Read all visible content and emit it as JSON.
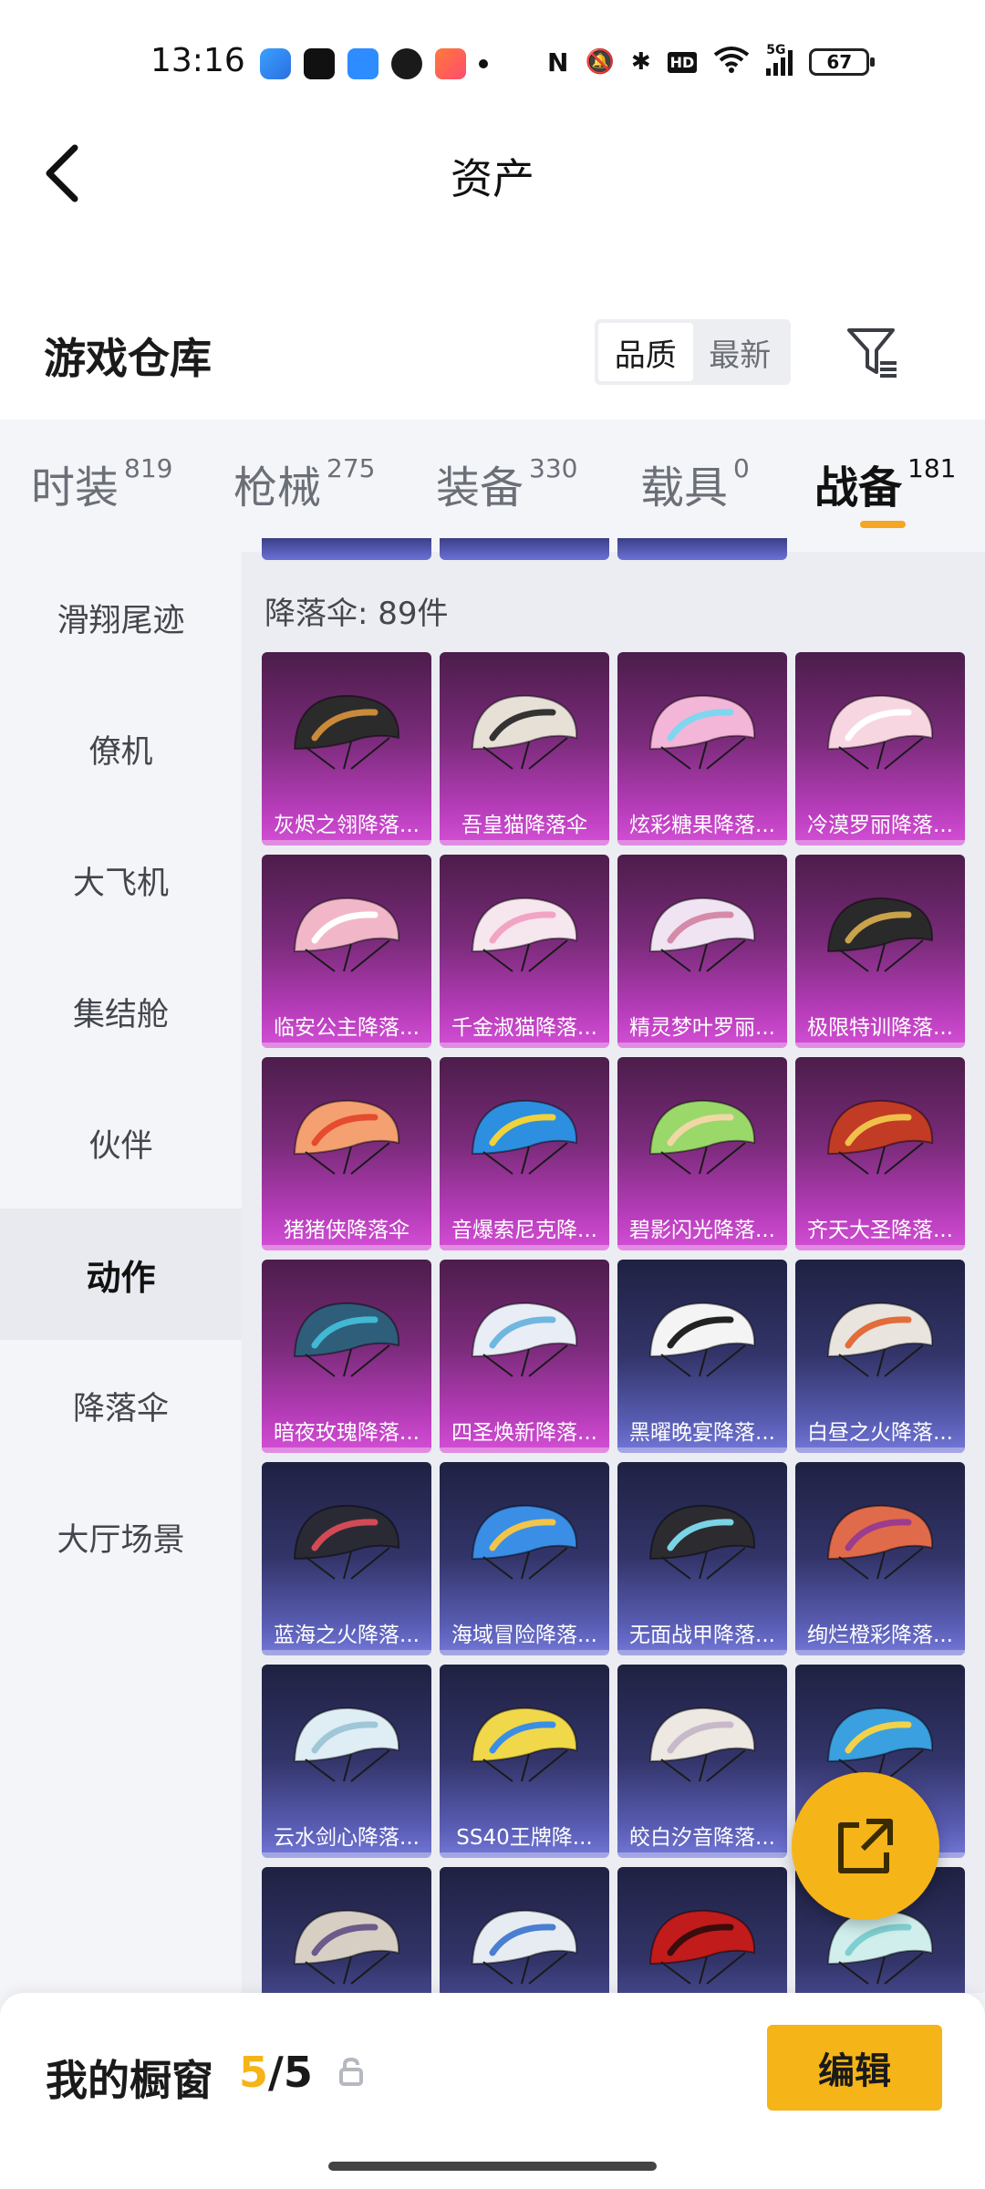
{
  "status_bar": {
    "time": "13:16",
    "network": "5G",
    "hd": "HD",
    "battery": "67",
    "icons": [
      "app-icon",
      "tiktok-icon",
      "app-icon",
      "wechat-icon",
      "game-icon",
      "dot-icon",
      "nfc-icon",
      "mute-icon",
      "bluetooth-icon",
      "wifi-icon",
      "signal-icon",
      "battery-icon"
    ]
  },
  "header": {
    "title": "资产",
    "back_icon": "chevron-left-icon"
  },
  "warehouse": {
    "title": "游戏仓库",
    "sort_options": [
      "品质",
      "最新"
    ],
    "active_sort": "品质",
    "filter_icon": "filter-icon"
  },
  "tabs": [
    {
      "label": "时装",
      "count": "819"
    },
    {
      "label": "枪械",
      "count": "275"
    },
    {
      "label": "装备",
      "count": "330"
    },
    {
      "label": "载具",
      "count": "0"
    },
    {
      "label": "战备",
      "count": "181"
    }
  ],
  "active_tab": "战备",
  "sidebar": {
    "items": [
      "滑翔尾迹",
      "僚机",
      "大飞机",
      "集结舱",
      "伙伴",
      "动作",
      "降落伞",
      "大厅场景"
    ],
    "active": "动作"
  },
  "grid": {
    "section_label": "降落伞: 89件",
    "items": [
      {
        "name": "灰烬之翎降落...",
        "tier": "pink",
        "color": "#2b2b2b",
        "accent": "#c98a3a"
      },
      {
        "name": "吾皇猫降落伞",
        "tier": "pink",
        "color": "#e6e0d6",
        "accent": "#333333"
      },
      {
        "name": "炫彩糖果降落...",
        "tier": "pink",
        "color": "#f3b5d8",
        "accent": "#7fd6ef"
      },
      {
        "name": "冷漠罗丽降落...",
        "tier": "pink",
        "color": "#f7d6e2",
        "accent": "#ffffff"
      },
      {
        "name": "临安公主降落...",
        "tier": "pink",
        "color": "#f1b7c9",
        "accent": "#ffffff"
      },
      {
        "name": "千金淑猫降落...",
        "tier": "pink",
        "color": "#f6e6ee",
        "accent": "#f2a4c4"
      },
      {
        "name": "精灵梦叶罗丽...",
        "tier": "pink",
        "color": "#f0e4f3",
        "accent": "#d58aa8"
      },
      {
        "name": "极限特训降落...",
        "tier": "pink",
        "color": "#2a2a2a",
        "accent": "#c9a24b"
      },
      {
        "name": "猪猪侠降落伞",
        "tier": "pink",
        "color": "#f4a070",
        "accent": "#e54b2d"
      },
      {
        "name": "音爆索尼克降...",
        "tier": "pink",
        "color": "#2d8fe0",
        "accent": "#f1d23a"
      },
      {
        "name": "碧影闪光降落...",
        "tier": "pink",
        "color": "#9ad86a",
        "accent": "#f2d7a6"
      },
      {
        "name": "齐天大圣降落...",
        "tier": "pink",
        "color": "#c23b25",
        "accent": "#f0c14a"
      },
      {
        "name": "暗夜玫瑰降落...",
        "tier": "pink",
        "color": "#2f5e7a",
        "accent": "#41b8d4"
      },
      {
        "name": "四圣焕新降落...",
        "tier": "pink",
        "color": "#e9eef6",
        "accent": "#6fb7e0"
      },
      {
        "name": "黑曜晚宴降落...",
        "tier": "blue",
        "color": "#f4f4f4",
        "accent": "#222222"
      },
      {
        "name": "白昼之火降落...",
        "tier": "blue",
        "color": "#e9e4de",
        "accent": "#e26c3a"
      },
      {
        "name": "蓝海之火降落...",
        "tier": "blue",
        "color": "#2a2a35",
        "accent": "#d24a56"
      },
      {
        "name": "海域冒险降落...",
        "tier": "blue",
        "color": "#3a8ee6",
        "accent": "#f2c54a"
      },
      {
        "name": "无面战甲降落...",
        "tier": "blue",
        "color": "#2c2c30",
        "accent": "#7bd4e6"
      },
      {
        "name": "绚烂橙彩降落...",
        "tier": "blue",
        "color": "#e06b4a",
        "accent": "#9b3c8c"
      },
      {
        "name": "云水剑心降落...",
        "tier": "blue",
        "color": "#dfeef5",
        "accent": "#9fc7d8"
      },
      {
        "name": "SS40王牌降...",
        "tier": "blue",
        "color": "#f0d84a",
        "accent": "#3a8ee6"
      },
      {
        "name": "皎白汐音降落...",
        "tier": "blue",
        "color": "#eee8e2",
        "accent": "#c7b9c9"
      },
      {
        "name": "",
        "tier": "blue",
        "color": "#3aa0e0",
        "accent": "#f2d24a"
      },
      {
        "name": "",
        "tier": "blue",
        "color": "#d8cfc4",
        "accent": "#6c5a8a"
      },
      {
        "name": "",
        "tier": "blue",
        "color": "#e7ecf2",
        "accent": "#4a7ed0"
      },
      {
        "name": "",
        "tier": "blue",
        "color": "#c21b1b",
        "accent": "#3a0d0d"
      },
      {
        "name": "",
        "tier": "blue",
        "color": "#cfeeec",
        "accent": "#7fcfd0"
      }
    ]
  },
  "fab": {
    "icon": "share-icon"
  },
  "bottom": {
    "label": "我的橱窗",
    "count_current": "5",
    "count_separator": "/",
    "count_total": "5",
    "lock_icon": "lock-icon",
    "edit_label": "编辑"
  }
}
